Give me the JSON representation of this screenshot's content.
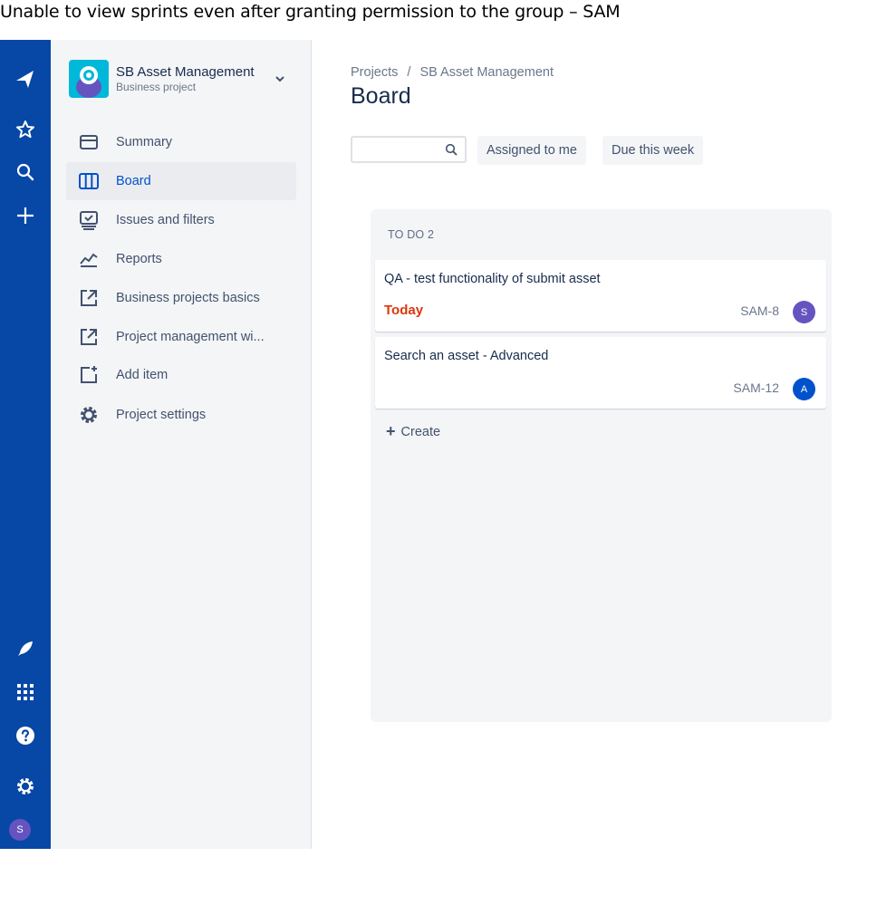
{
  "caption": "Unable to view sprints even after granting permission to the group – SAM",
  "project": {
    "name": "SB Asset Management",
    "type": "Business project"
  },
  "sidebar": {
    "items": [
      {
        "label": "Summary",
        "icon": "summary-icon"
      },
      {
        "label": "Board",
        "icon": "board-icon",
        "active": true
      },
      {
        "label": "Issues and filters",
        "icon": "issues-icon"
      },
      {
        "label": "Reports",
        "icon": "reports-icon"
      },
      {
        "label": "Business projects basics",
        "icon": "external-link-icon"
      },
      {
        "label": "Project management wi...",
        "icon": "external-link-icon"
      },
      {
        "label": "Add item",
        "icon": "add-item-icon"
      },
      {
        "label": "Project settings",
        "icon": "gear-icon"
      }
    ]
  },
  "globalnav": {
    "avatar_initial": "S"
  },
  "main": {
    "breadcrumb": [
      "Projects",
      "/",
      "SB Asset Management"
    ],
    "title": "Board",
    "search": {
      "value": "",
      "placeholder": ""
    },
    "filters": [
      "Assigned to me",
      "Due this week"
    ]
  },
  "board": {
    "column_header": "TO DO 2",
    "cards": [
      {
        "title": "QA - test functionality of submit asset",
        "due": "Today",
        "key": "SAM-8",
        "avatar": "S",
        "avatar_color": "#6554c0"
      },
      {
        "title": "Search an asset - Advanced",
        "due": "",
        "key": "SAM-12",
        "avatar": "A",
        "avatar_color": "#0052cc"
      }
    ],
    "create_label": "Create"
  },
  "colors": {
    "global_nav": "#0747a6",
    "active_text": "#0052cc",
    "due_today": "#de350b"
  }
}
